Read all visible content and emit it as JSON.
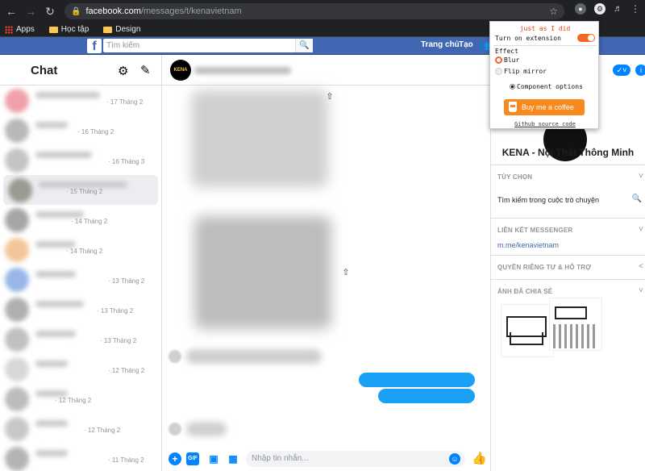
{
  "browser": {
    "url_host": "facebook.com",
    "url_path": "/messages/t/kenavietnam",
    "bookmarks": [
      {
        "label": "Apps"
      },
      {
        "label": "Học tập"
      },
      {
        "label": "Design"
      }
    ]
  },
  "fb_header": {
    "search_placeholder": "Tìm kiếm",
    "home_label": "Trang chủ",
    "create_label": "Tạo"
  },
  "chat_list": {
    "title": "Chat",
    "conversations": [
      {
        "date": "· 17 Tháng 2",
        "avatar_color": "#f0a0a8"
      },
      {
        "date": "· 16 Tháng 2",
        "avatar_color": "#b8b8b8"
      },
      {
        "date": "· 16 Tháng 3",
        "avatar_color": "#c4c4c4"
      },
      {
        "date": "· 15 Tháng 2",
        "avatar_color": "#9a9a90"
      },
      {
        "date": "· 14 Tháng 2",
        "avatar_color": "#a6a6a6"
      },
      {
        "date": "· 14 Tháng 2",
        "avatar_color": "#f2c69a"
      },
      {
        "date": "· 13 Tháng 2",
        "avatar_color": "#9ab6e8"
      },
      {
        "date": "· 13 Tháng 2",
        "avatar_color": "#b0b0b0"
      },
      {
        "date": "· 13 Tháng 2",
        "avatar_color": "#c0c0c0"
      },
      {
        "date": "· 12 Tháng 2",
        "avatar_color": "#d8d8d8"
      },
      {
        "date": "· 12 Tháng 2",
        "avatar_color": "#bcbcbc"
      },
      {
        "date": "· 12 Tháng 2",
        "avatar_color": "#c8c8c8"
      },
      {
        "date": "· 11 Tháng 2",
        "avatar_color": "#b4b4b4"
      }
    ]
  },
  "conversation": {
    "avatar_text": "KENA",
    "composer_placeholder": "Nhập tin nhắn..."
  },
  "info_panel": {
    "page_name": "KENA - Nội Thất Thông Minh",
    "options_header": "TÙY CHỌN",
    "search_in_conversation": "Tìm kiếm trong cuộc trò chuyện",
    "messenger_link_header": "LIÊN KẾT MESSENGER",
    "messenger_link": "m.me/kenavietnam",
    "privacy_header": "QUYỀN RIÊNG TƯ & HỖ TRỢ",
    "shared_photos_header": "ẢNH ĐÃ CHIA SẺ"
  },
  "extension_popup": {
    "title": "just as I did",
    "turn_on_label": "Turn on extension",
    "effect_label": "Effect",
    "blur_label": "Blur",
    "flip_label": "Flip mirror",
    "component_options_label": "Component options",
    "coffee_label": "Buy me a coffee",
    "github_label": "Github source code",
    "extension_enabled": true,
    "selected_effect": "Blur"
  },
  "colors": {
    "fb_blue": "#4267b2",
    "messenger_blue": "#0084ff",
    "sent_bubble": "#1aa1f5",
    "coffee_orange": "#f7891f",
    "popup_title": "#e0461b"
  }
}
